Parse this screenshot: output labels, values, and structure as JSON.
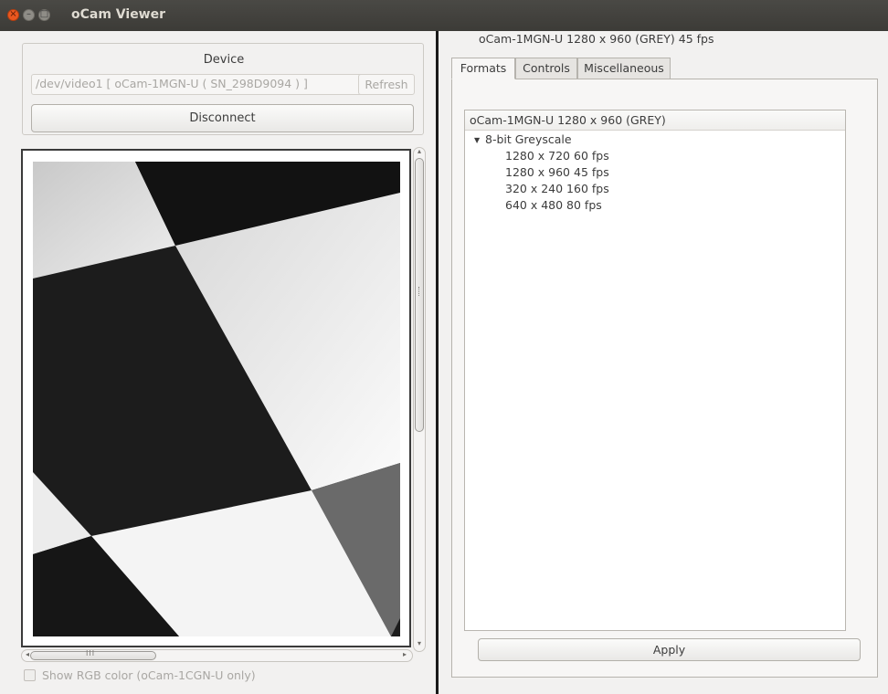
{
  "window": {
    "title": "oCam Viewer",
    "buttons": {
      "close": "×",
      "minimize": "–",
      "maximize": "□"
    }
  },
  "device": {
    "group_title": "Device",
    "selected": "/dev/video1 [ oCam-1MGN-U ( SN_298D9094 ) ]",
    "refresh_label": "Refresh",
    "disconnect_label": "Disconnect"
  },
  "viewer": {
    "show_rgb_label": "Show RGB color (oCam-1CGN-U only)",
    "show_rgb_checked": false,
    "hscroll_grip": "III"
  },
  "right": {
    "camera_header": "oCam-1MGN-U  1280 x 960 (GREY)  45 fps",
    "tabs": [
      {
        "label": "Formats",
        "active": true
      },
      {
        "label": "Controls",
        "active": false
      },
      {
        "label": "Miscellaneous",
        "active": false
      }
    ],
    "tree": {
      "header": "oCam-1MGN-U  1280 x 960 (GREY)",
      "node": "8-bit Greyscale",
      "items": [
        "1280 x 720 60 fps",
        "1280 x 960 45 fps",
        "320 x 240 160 fps",
        "640 x 480 80 fps"
      ]
    },
    "apply_label": "Apply"
  },
  "icons": {
    "disclosure": "▼",
    "combo_arrow": "⬍",
    "scroll_up": "▴",
    "scroll_down": "▾",
    "scroll_left": "◂",
    "scroll_right": "▸"
  },
  "colors": {
    "titlebar": "#3c3b37",
    "close_button": "#e9571f",
    "window_bg": "#f2f1f0",
    "divider": "#1a1a1a"
  }
}
